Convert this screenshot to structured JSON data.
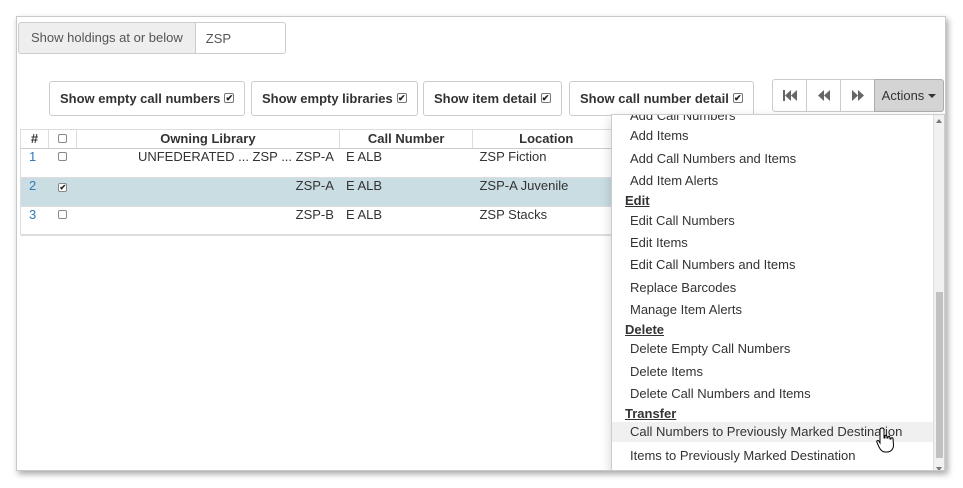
{
  "holdings": {
    "label": "Show holdings at or below",
    "value": "ZSP"
  },
  "toggles": [
    {
      "label": "Show empty call numbers",
      "checked": true
    },
    {
      "label": "Show empty libraries",
      "checked": true
    },
    {
      "label": "Show item detail",
      "checked": true
    },
    {
      "label": "Show call number detail",
      "checked": true
    }
  ],
  "pager": {
    "first_icon": "first-page-icon",
    "prev_icon": "prev-page-icon",
    "next_icon": "next-page-icon"
  },
  "actions": {
    "label": "Actions"
  },
  "grid": {
    "headers": {
      "num": "#",
      "owning_library": "Owning Library",
      "call_number": "Call Number",
      "location": "Location"
    },
    "rows": [
      {
        "num": "1",
        "checked": false,
        "owning_library": "UNFEDERATED ... ZSP ... ZSP-A",
        "call_number": "E ALB",
        "location": "ZSP Fiction"
      },
      {
        "num": "2",
        "checked": true,
        "owning_library": "ZSP-A",
        "call_number": "E ALB",
        "location": "ZSP-A Juvenile"
      },
      {
        "num": "3",
        "checked": false,
        "owning_library": "ZSP-B",
        "call_number": "E ALB",
        "location": "ZSP Stacks"
      }
    ]
  },
  "menu": {
    "add_partial": "Add Call Numbers",
    "add_items": "Add Items",
    "add_call_numbers_items": "Add Call Numbers and Items",
    "add_item_alerts": "Add Item Alerts",
    "edit_header": "Edit",
    "edit_call_numbers": "Edit Call Numbers",
    "edit_items": "Edit Items",
    "edit_call_numbers_items": "Edit Call Numbers and Items",
    "replace_barcodes": "Replace Barcodes",
    "manage_item_alerts": "Manage Item Alerts",
    "delete_header": "Delete",
    "delete_empty_call_numbers": "Delete Empty Call Numbers",
    "delete_items": "Delete Items",
    "delete_call_numbers_items": "Delete Call Numbers and Items",
    "transfer_header": "Transfer",
    "transfer_call_numbers": "Call Numbers to Previously Marked Destination",
    "transfer_items": "Items to Previously Marked Destination"
  }
}
